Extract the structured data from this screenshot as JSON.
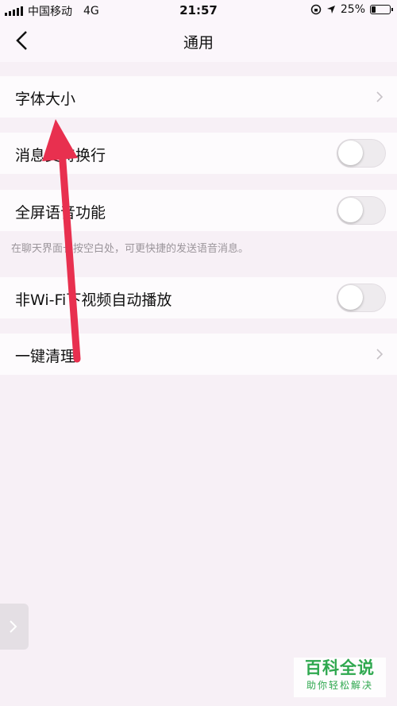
{
  "status_bar": {
    "carrier": "中国移动",
    "network": "4G",
    "time": "21:57",
    "battery": "25%",
    "battery_level": 0.25
  },
  "header": {
    "title": "通用"
  },
  "settings": {
    "font_size": "字体大小",
    "message_wrap": "消息支持换行",
    "fullscreen_voice": "全屏语音功能",
    "fullscreen_voice_hint": "在聊天界面长按空白处，可更快捷的发送语音消息。",
    "autoplay_video": "非Wi-Fi下视频自动播放",
    "one_key_clean": "一键清理"
  },
  "toggles": {
    "message_wrap": false,
    "fullscreen_voice": false,
    "autoplay_video": false
  },
  "watermark": {
    "title": "百科全说",
    "subtitle": "助你轻松解决"
  },
  "colors": {
    "arrow": "#e8304f",
    "watermark": "#2fa84f"
  },
  "icons": [
    "back-icon",
    "chevron-right-icon",
    "annotation-arrow-icon"
  ]
}
